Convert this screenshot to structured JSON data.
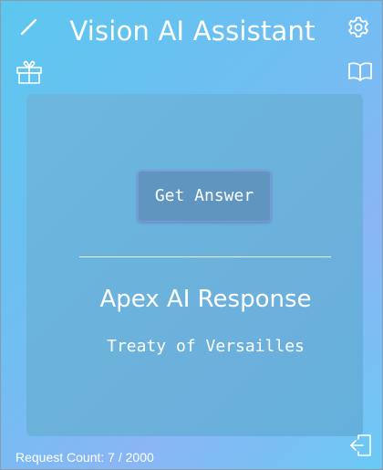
{
  "header": {
    "title": "Vision AI Assistant",
    "icons": {
      "left_top": "pencil-icon",
      "right_top": "gear-icon",
      "left_second": "gift-icon",
      "right_second": "book-icon"
    }
  },
  "card": {
    "button_label": "Get Answer",
    "response_title": "Apex AI Response",
    "response_text": "Treaty of Versailles"
  },
  "footer": {
    "request_count_label": "Request Count: 7 / 2000",
    "exit_icon": "logout-icon"
  },
  "colors": {
    "background_start": "#5cc7ef",
    "background_end": "#8ab6f5",
    "card": "#6eb4dc",
    "button": "#5f95be",
    "button_border": "#8e8fe0",
    "text": "#ffffff"
  }
}
